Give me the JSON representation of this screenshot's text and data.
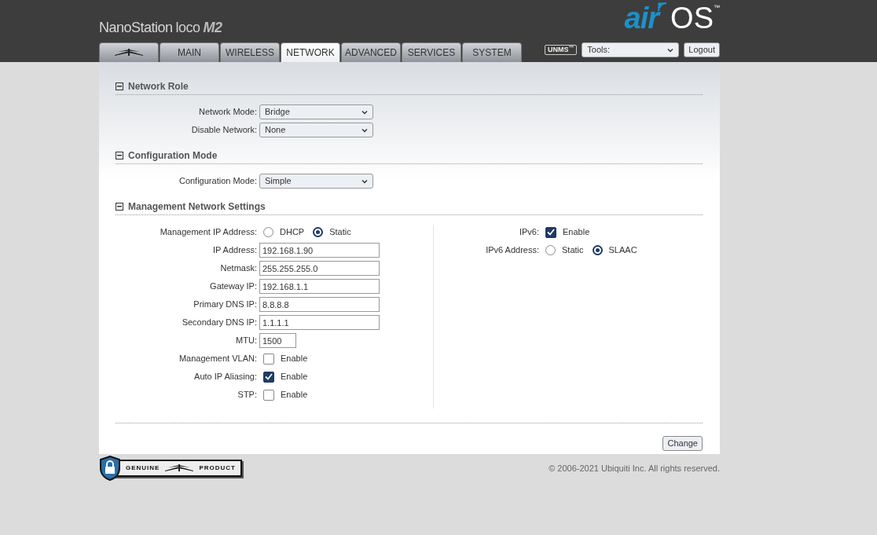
{
  "header": {
    "product": "NanoStation",
    "product_sub": "loco",
    "model": "M2",
    "logo_air": "air",
    "logo_os": "OS",
    "logo_tm": "™"
  },
  "tabs": [
    {
      "kind": "icon",
      "selected": false
    },
    {
      "kind": "text",
      "label": "MAIN",
      "selected": false
    },
    {
      "kind": "text",
      "label": "WIRELESS",
      "selected": false
    },
    {
      "kind": "text",
      "label": "NETWORK",
      "selected": true
    },
    {
      "kind": "text",
      "label": "ADVANCED",
      "selected": false
    },
    {
      "kind": "text",
      "label": "SERVICES",
      "selected": false
    },
    {
      "kind": "text",
      "label": "SYSTEM",
      "selected": false
    }
  ],
  "toolbar": {
    "unms": "UNMS",
    "unms_tm": "™",
    "tools": "Tools:",
    "logout": "Logout"
  },
  "sections": [
    {
      "title": "Network Role",
      "expanded": true,
      "rows": [
        {
          "kind": "select",
          "label": "Network Mode:",
          "value": "Bridge"
        },
        {
          "kind": "select",
          "label": "Disable Network:",
          "value": "None"
        }
      ]
    },
    {
      "title": "Configuration Mode",
      "expanded": true,
      "rows": [
        {
          "kind": "select",
          "label": "Configuration Mode:",
          "value": "Simple"
        }
      ]
    },
    {
      "title": "Management Network Settings",
      "expanded": true,
      "rows": [
        {
          "kind": "radio",
          "label": "Management IP Address:",
          "options": [
            {
              "label": "DHCP",
              "selected": false
            },
            {
              "label": "Static",
              "selected": true
            }
          ]
        },
        {
          "kind": "text",
          "label": "IP Address:",
          "value": "192.168.1.90"
        },
        {
          "kind": "text",
          "label": "Netmask:",
          "value": "255.255.255.0"
        },
        {
          "kind": "text",
          "label": "Gateway IP:",
          "value": "192.168.1.1"
        },
        {
          "kind": "text",
          "label": "Primary DNS IP:",
          "value": "8.8.8.8"
        },
        {
          "kind": "text",
          "label": "Secondary DNS IP:",
          "value": "1.1.1.1"
        },
        {
          "kind": "short_text",
          "label": "MTU:",
          "value": "1500"
        },
        {
          "kind": "checkbox",
          "label": "Management VLAN:",
          "option": "Enable",
          "checked": false
        },
        {
          "kind": "checkbox",
          "label": "Auto IP Aliasing:",
          "option": "Enable",
          "checked": true
        },
        {
          "kind": "checkbox",
          "label": "STP:",
          "option": "Enable",
          "checked": false
        }
      ],
      "side_rows": [
        {
          "kind": "checkbox",
          "label": "IPv6:",
          "option": "Enable",
          "checked": true
        },
        {
          "kind": "radio",
          "label": "IPv6 Address:",
          "options": [
            {
              "label": "Static",
              "selected": false
            },
            {
              "label": "SLAAC",
              "selected": true
            }
          ]
        }
      ]
    }
  ],
  "change_button": "Change",
  "footer": {
    "badge_left": "GENUINE",
    "badge_right": "PRODUCT",
    "copyright": "© 2006-2021 Ubiquiti Inc. All rights reserved."
  }
}
